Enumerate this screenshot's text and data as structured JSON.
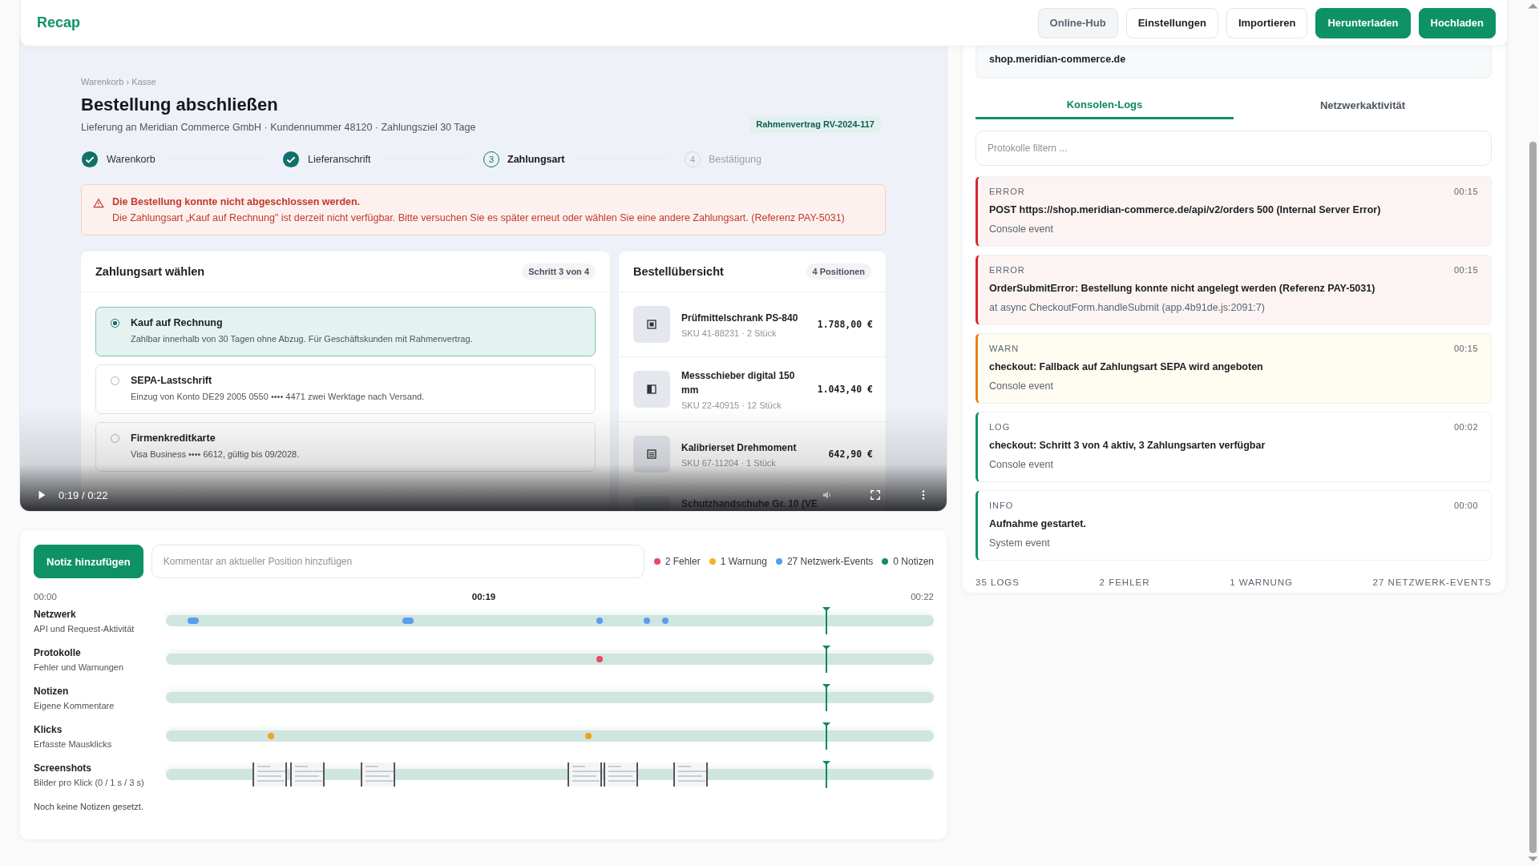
{
  "app": {
    "logo": "Recap"
  },
  "toolbar": [
    {
      "label": "Online-Hub",
      "kind": "muted"
    },
    {
      "label": "Einstellungen",
      "kind": "outline"
    },
    {
      "label": "Importieren",
      "kind": "outline"
    },
    {
      "label": "Herunterladen",
      "kind": "primary"
    },
    {
      "label": "Hochladen",
      "kind": "primary"
    }
  ],
  "recording": {
    "page": {
      "breadcrumb": "Warenkorb › Kasse",
      "title": "Bestellung abschließen",
      "subtitle": "Lieferung an Meridian Commerce GmbH · Kundennummer 48120 · Zahlungsziel 30 Tage",
      "contract_badge": "Rahmenvertrag RV-2024-117",
      "steps": [
        {
          "label": "Warenkorb",
          "done": true,
          "current": false
        },
        {
          "label": "Lieferanschrift",
          "done": true,
          "current": false
        },
        {
          "number": "3",
          "label": "Zahlungsart",
          "done": false,
          "current": true
        },
        {
          "number": "4",
          "label": "Bestätigung",
          "done": false,
          "current": false
        }
      ],
      "alert": {
        "title": "Die Bestellung konnte nicht abgeschlossen werden.",
        "message": "Die Zahlungsart „Kauf auf Rechnung\" ist derzeit nicht verfügbar. Bitte versuchen Sie es später erneut oder wählen Sie eine andere Zahlungsart. (Referenz PAY-5031)"
      },
      "payment": {
        "title": "Zahlungsart wählen",
        "badge": "Schritt 3 von 4",
        "options": [
          {
            "name": "Kauf auf Rechnung",
            "description": "Zahlbar innerhalb von 30 Tagen ohne Abzug. Für Geschäftskunden mit Rahmenvertrag.",
            "selected": true
          },
          {
            "name": "SEPA-Lastschrift",
            "description": "Einzug von Konto DE29 2005 0550 •••• 4471 zwei Werktage nach Versand.",
            "selected": false
          },
          {
            "name": "Firmenkreditkarte",
            "description": "Visa Business •••• 6612, gültig bis 09/2028.",
            "selected": false
          }
        ]
      },
      "summary": {
        "title": "Bestellübersicht",
        "badge": "4 Positionen",
        "items": [
          {
            "name": "Prüfmittelschrank PS-840",
            "details": "SKU 41-88231 · 2 Stück",
            "price": "1.788,00 €"
          },
          {
            "name": "Messschieber digital 150 mm",
            "details": "SKU 22-40915 · 12 Stück",
            "price": "1.043,40 €"
          },
          {
            "name": "Kalibrierset Drehmoment",
            "details": "SKU 67-11204 · 1 Stück",
            "price": "642,90 €"
          },
          {
            "name": "Schutzhandschuhe Gr. 10 (VE"
          }
        ]
      }
    },
    "player": {
      "time": "0:19 / 0:22"
    }
  },
  "notes": {
    "add_button": "Notiz hinzufügen",
    "comment_placeholder": "Kommentar an aktueller Position hinzufügen",
    "legend": [
      {
        "label": "2 Fehler",
        "color": "#e9476b"
      },
      {
        "label": "1 Warnung",
        "color": "#f3b41f"
      },
      {
        "label": "27 Netzwerk-Events",
        "color": "#5b9ded"
      },
      {
        "label": "0 Notizen",
        "color": "#0e9265"
      }
    ],
    "empty_text": "Noch keine Notizen gesetzt."
  },
  "timeline": {
    "start": "00:00",
    "current": "00:19",
    "end": "00:22",
    "playhead": {
      "level": 0.86
    },
    "tracks": [
      {
        "title": "Netzwerk",
        "subtitle": "API und Request-Aktivität",
        "kind": "events",
        "markers": [
          {
            "level": 0.035,
            "kind": "wide",
            "color": "#5b9ded"
          },
          {
            "level": 0.315,
            "kind": "wide",
            "color": "#5b9ded"
          },
          {
            "level": 0.565,
            "kind": "dot",
            "color": "#5b9ded"
          },
          {
            "level": 0.626,
            "kind": "dot",
            "color": "#5b9ded"
          },
          {
            "level": 0.65,
            "kind": "dot",
            "color": "#5b9ded"
          }
        ]
      },
      {
        "title": "Protokolle",
        "subtitle": "Fehler und Warnungen",
        "kind": "events",
        "markers": [
          {
            "level": 0.565,
            "kind": "dot",
            "color": "#e9476b"
          }
        ]
      },
      {
        "title": "Notizen",
        "subtitle": "Eigene Kommentare",
        "kind": "events"
      },
      {
        "title": "Klicks",
        "subtitle": "Erfasste Mausklicks",
        "kind": "events",
        "markers": [
          {
            "level": 0.137,
            "kind": "dot",
            "color": "#f0a020"
          },
          {
            "level": 0.55,
            "kind": "dot",
            "color": "#f0a020"
          }
        ]
      },
      {
        "title": "Screenshots",
        "subtitle": "Bilder pro Klick (0 / 1 s / 3 s)",
        "kind": "screenshots",
        "thumbnails": [
          {
            "kind": "screenshot"
          },
          {
            "kind": "screenshot"
          },
          {
            "kind": "screenshot"
          },
          {
            "kind": "screenshot"
          },
          {
            "kind": "screenshot"
          },
          {
            "kind": "screenshot"
          }
        ]
      }
    ]
  },
  "inspector": {
    "host": "shop.meridian-commerce.de",
    "tabs": [
      {
        "label": "Konsolen-Logs",
        "selected": true
      },
      {
        "label": "Netzwerkaktivität",
        "selected": false
      }
    ],
    "filter": {
      "placeholder": "Protokolle filtern ..."
    },
    "logs": [
      {
        "kind": "error",
        "label": "ERROR",
        "time": "00:15",
        "message": "POST https://shop.meridian-commerce.de/api/v2/orders 500 (Internal Server Error)",
        "source": "Console event"
      },
      {
        "kind": "error",
        "label": "ERROR",
        "time": "00:15",
        "message": "OrderSubmitError: Bestellung konnte nicht angelegt werden (Referenz PAY-5031)",
        "source": "at async CheckoutForm.handleSubmit (app.4b91de.js:2091:7)"
      },
      {
        "kind": "warn",
        "label": "WARN",
        "time": "00:15",
        "message": "checkout: Fallback auf Zahlungsart SEPA wird angeboten",
        "source": "Console event"
      },
      {
        "kind": "log",
        "label": "LOG",
        "time": "00:02",
        "message": "checkout: Schritt 3 von 4 aktiv, 3 Zahlungsarten verfügbar",
        "source": "Console event"
      },
      {
        "kind": "info",
        "label": "INFO",
        "time": "00:00",
        "message": "Aufnahme gestartet.",
        "source": "System event"
      }
    ],
    "counts": [
      "35 LOGS",
      "2 FEHLER",
      "1 WARNUNG",
      "27 NETZWERK-EVENTS"
    ]
  }
}
